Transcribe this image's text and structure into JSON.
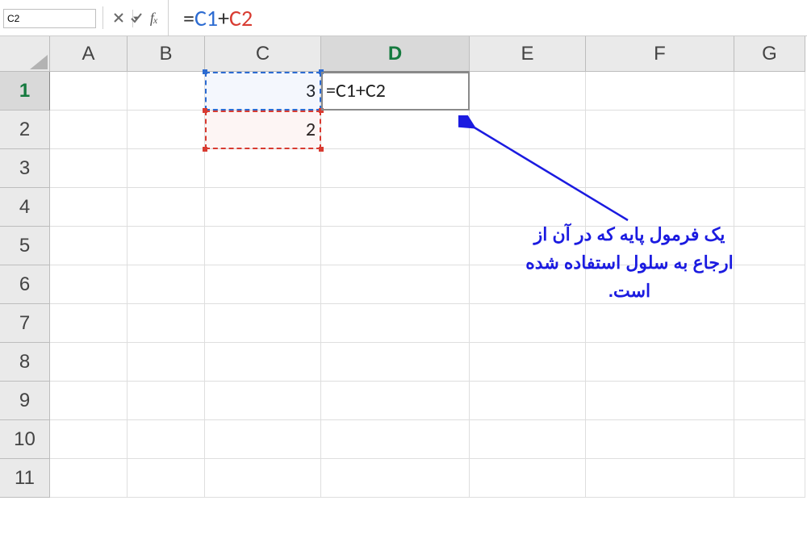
{
  "name_box": {
    "value": "C2"
  },
  "formula_bar": {
    "prefix_eq": "=",
    "ref1": "C1",
    "plus": "+",
    "ref2": "C2"
  },
  "columns": [
    "A",
    "B",
    "C",
    "D",
    "E",
    "F",
    "G"
  ],
  "active_column": "D",
  "row_headers": [
    "1",
    "2",
    "3",
    "4",
    "5",
    "6",
    "7",
    "8",
    "9",
    "10",
    "11"
  ],
  "active_row": "1",
  "cells": {
    "C1": "3",
    "C2": "2",
    "D1": "=C1+C2"
  },
  "annotation": {
    "text": "یک فرمول پایه که در آن از ارجاع به سلول استفاده شده است."
  }
}
